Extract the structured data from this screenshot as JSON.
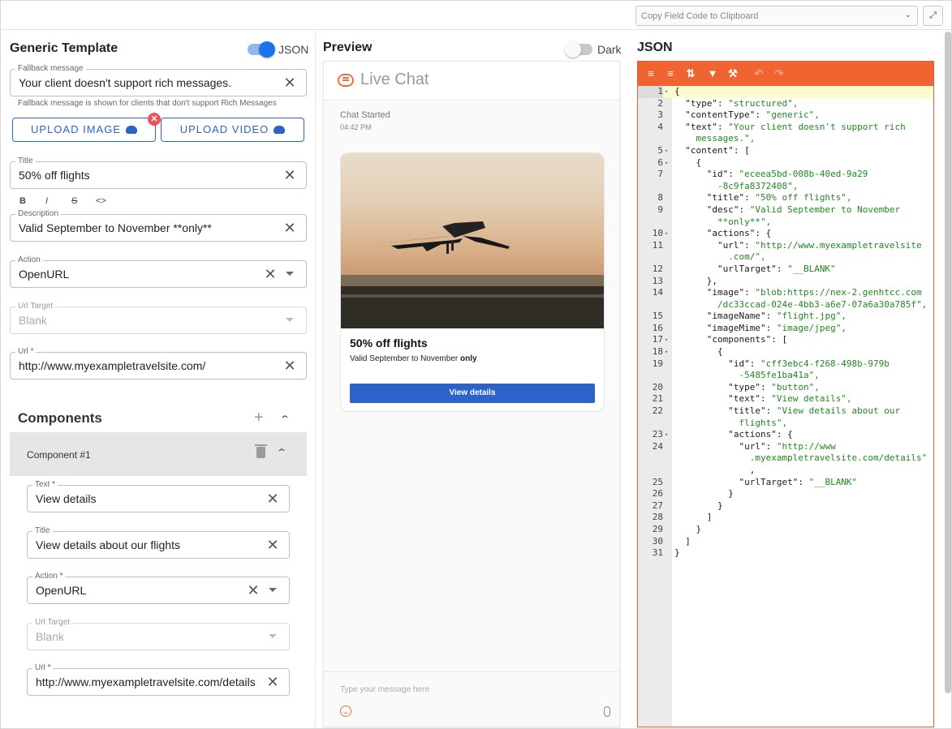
{
  "topbar": {
    "copy_placeholder": "Copy Field Code to Clipboard"
  },
  "left": {
    "title": "Generic Template",
    "json_toggle_label": "JSON",
    "json_toggle_on": true,
    "fallback": {
      "label": "Fallback message",
      "value": "Your client doesn't support rich messages.",
      "helper": "Fallback message is shown for clients that don't support Rich Messages"
    },
    "upload_image": "UPLOAD IMAGE",
    "upload_video": "UPLOAD VIDEO",
    "title_field": {
      "label": "Title",
      "value": "50% off flights"
    },
    "format_buttons": [
      "B",
      "I",
      "S",
      "<>"
    ],
    "description": {
      "label": "Description",
      "value": "Valid September to November **only**"
    },
    "action": {
      "label": "Action",
      "value": "OpenURL"
    },
    "url_target": {
      "label": "Url Target",
      "value": "Blank"
    },
    "url": {
      "label": "Url",
      "required": "*",
      "value": "http://www.myexampletravelsite.com/"
    },
    "components_title": "Components",
    "component": {
      "label": "Component #1",
      "text": {
        "label": "Text",
        "required": "*",
        "value": "View details"
      },
      "title": {
        "label": "Title",
        "value": "View details about our flights"
      },
      "action": {
        "label": "Action",
        "required": "*",
        "value": "OpenURL"
      },
      "url_target": {
        "label": "Url Target",
        "value": "Blank"
      },
      "url": {
        "label": "Url",
        "required": "*",
        "value": "http://www.myexampletravelsite.com/details"
      }
    }
  },
  "preview": {
    "heading": "Preview",
    "dark_label": "Dark",
    "dark_on": false,
    "live_chat": "Live Chat",
    "chat_started": "Chat Started",
    "time": "04:42 PM",
    "card_title": "50% off flights",
    "card_desc_prefix": "Valid September to November ",
    "card_desc_bold": "only",
    "card_button": "View details",
    "message_placeholder": "Type your message here"
  },
  "json": {
    "heading": "JSON",
    "lines": [
      {
        "n": "1",
        "fold": true,
        "t": "{"
      },
      {
        "n": "2",
        "fold": false,
        "t": "  \"type\": \"structured\","
      },
      {
        "n": "3",
        "fold": false,
        "t": "  \"contentType\": \"generic\","
      },
      {
        "n": "4",
        "fold": false,
        "t": "  \"text\": \"Your client doesn't support rich"
      },
      {
        "n": "",
        "fold": false,
        "t": "    messages.\","
      },
      {
        "n": "5",
        "fold": true,
        "t": "  \"content\": ["
      },
      {
        "n": "6",
        "fold": true,
        "t": "    {"
      },
      {
        "n": "7",
        "fold": false,
        "t": "      \"id\": \"eceea5bd-008b-40ed-9a29"
      },
      {
        "n": "",
        "fold": false,
        "t": "        -8c9fa8372408\","
      },
      {
        "n": "8",
        "fold": false,
        "t": "      \"title\": \"50% off flights\","
      },
      {
        "n": "9",
        "fold": false,
        "t": "      \"desc\": \"Valid September to November"
      },
      {
        "n": "",
        "fold": false,
        "t": "        **only**\","
      },
      {
        "n": "10",
        "fold": true,
        "t": "      \"actions\": {"
      },
      {
        "n": "11",
        "fold": false,
        "t": "        \"url\": \"http://www.myexampletravelsite"
      },
      {
        "n": "",
        "fold": false,
        "t": "          .com/\","
      },
      {
        "n": "12",
        "fold": false,
        "t": "        \"urlTarget\": \"__BLANK\""
      },
      {
        "n": "13",
        "fold": false,
        "t": "      },"
      },
      {
        "n": "14",
        "fold": false,
        "t": "      \"image\": \"blob:https://nex-2.genhtcc.com"
      },
      {
        "n": "",
        "fold": false,
        "t": "        /dc33ccad-024e-4bb3-a6e7-07a6a30a785f\","
      },
      {
        "n": "15",
        "fold": false,
        "t": "      \"imageName\": \"flight.jpg\","
      },
      {
        "n": "16",
        "fold": false,
        "t": "      \"imageMime\": \"image/jpeg\","
      },
      {
        "n": "17",
        "fold": true,
        "t": "      \"components\": ["
      },
      {
        "n": "18",
        "fold": true,
        "t": "        {"
      },
      {
        "n": "19",
        "fold": false,
        "t": "          \"id\": \"cff3ebc4-f268-498b-979b"
      },
      {
        "n": "",
        "fold": false,
        "t": "            -5485fe1ba41a\","
      },
      {
        "n": "20",
        "fold": false,
        "t": "          \"type\": \"button\","
      },
      {
        "n": "21",
        "fold": false,
        "t": "          \"text\": \"View details\","
      },
      {
        "n": "22",
        "fold": false,
        "t": "          \"title\": \"View details about our"
      },
      {
        "n": "",
        "fold": false,
        "t": "            flights\","
      },
      {
        "n": "23",
        "fold": true,
        "t": "          \"actions\": {"
      },
      {
        "n": "24",
        "fold": false,
        "t": "            \"url\": \"http://www"
      },
      {
        "n": "",
        "fold": false,
        "t": "              .myexampletravelsite.com/details\""
      },
      {
        "n": "",
        "fold": false,
        "t": "              ,"
      },
      {
        "n": "25",
        "fold": false,
        "t": "            \"urlTarget\": \"__BLANK\""
      },
      {
        "n": "26",
        "fold": false,
        "t": "          }"
      },
      {
        "n": "27",
        "fold": false,
        "t": "        }"
      },
      {
        "n": "28",
        "fold": false,
        "t": "      ]"
      },
      {
        "n": "29",
        "fold": false,
        "t": "    }"
      },
      {
        "n": "30",
        "fold": false,
        "t": "  ]"
      },
      {
        "n": "31",
        "fold": false,
        "t": "}"
      }
    ]
  }
}
